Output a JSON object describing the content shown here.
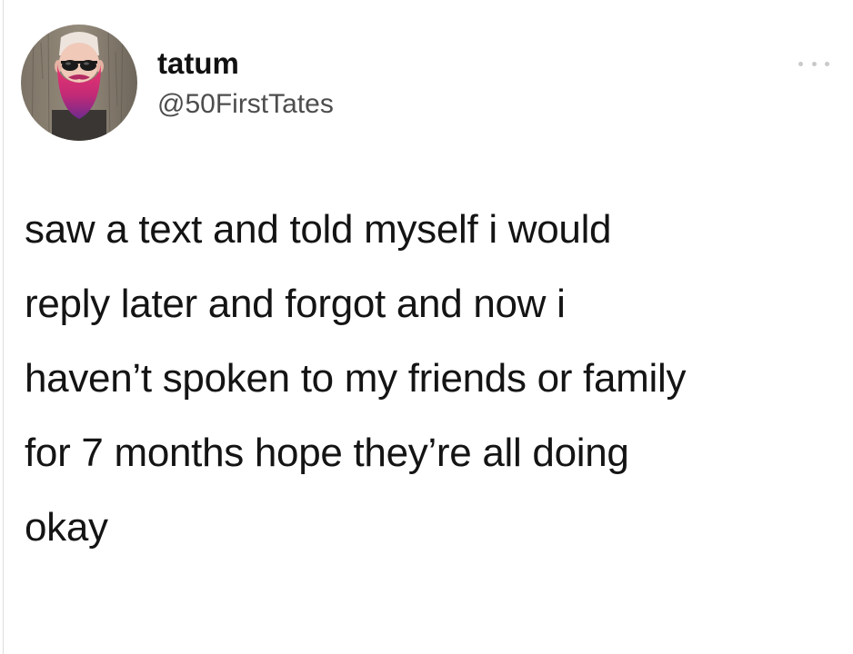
{
  "tweet": {
    "display_name": "tatum",
    "handle": "@50FirstTates",
    "more_icon": "more-horizontal-icon",
    "text": "saw a text and told myself i would\nreply later and forgot and now i\nhaven’t spoken to my friends or family\nfor 7 months hope they’re all doing\nokay"
  },
  "avatar": {
    "description_icon": "bearded-man-avatar",
    "colors": {
      "background_wood": "#8a7f70",
      "beard_pink": "#d9306f",
      "beard_purple": "#7a2c8f",
      "sunglasses": "#1a1a1a",
      "skin": "#f0c9b8"
    }
  },
  "colors": {
    "background": "#ffffff",
    "text": "#141414",
    "handle": "#4d4d4d",
    "menu_dots": "#c9c9c9"
  }
}
